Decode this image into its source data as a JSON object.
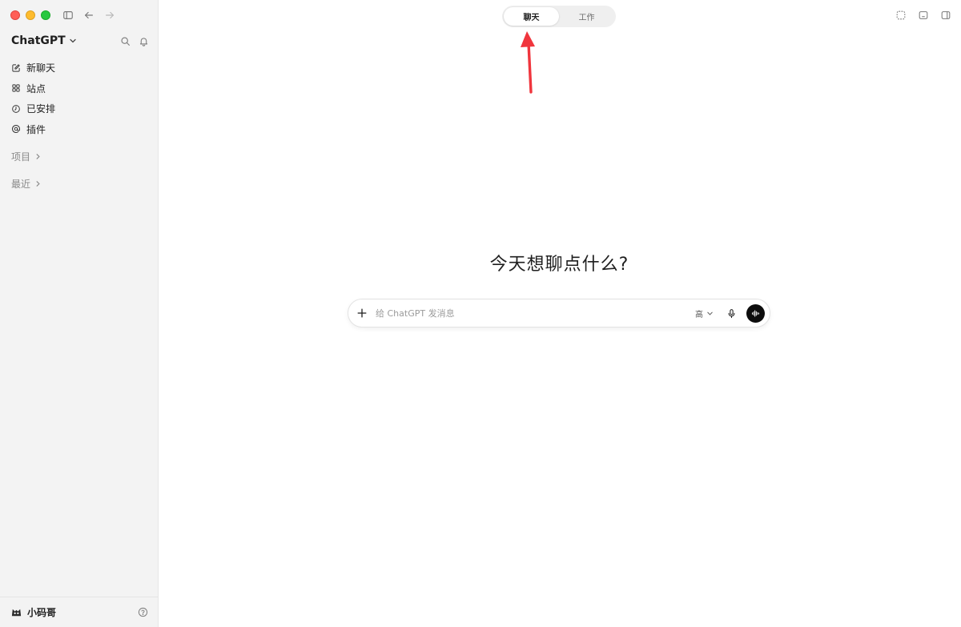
{
  "window": {
    "traffic_lights": [
      "close",
      "minimize",
      "zoom"
    ],
    "toolbar_icons": [
      "sidebar-toggle-icon",
      "back-arrow-icon",
      "forward-arrow-icon"
    ]
  },
  "sidebar": {
    "brand": "ChatGPT",
    "brand_icons": [
      "search-icon",
      "bell-icon"
    ],
    "nav": [
      {
        "label": "新聊天",
        "icon": "edit-icon"
      },
      {
        "label": "站点",
        "icon": "grid-icon"
      },
      {
        "label": "已安排",
        "icon": "clock-icon"
      },
      {
        "label": "插件",
        "icon": "at-icon"
      }
    ],
    "sections": [
      {
        "label": "项目"
      },
      {
        "label": "最近"
      }
    ],
    "footer": {
      "username": "小码哥",
      "help_icon": "help-icon"
    }
  },
  "main": {
    "mode_tabs": [
      {
        "label": "聊天",
        "active": true
      },
      {
        "label": "工作",
        "active": false
      }
    ],
    "window_actions": [
      "screenshot-icon",
      "mini-window-icon",
      "sidebar-right-icon"
    ],
    "heading": "今天想聊点什么?",
    "composer": {
      "placeholder": "给 ChatGPT 发消息",
      "model_label": "高",
      "icons": [
        "plus-icon",
        "microphone-icon",
        "voice-mode-icon"
      ]
    },
    "annotation_color": "#f0353d"
  }
}
